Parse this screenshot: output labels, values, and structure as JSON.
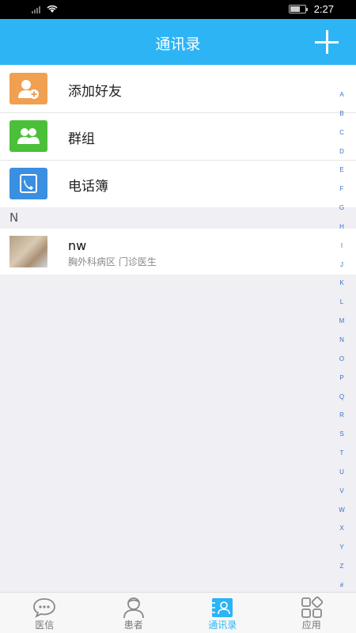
{
  "status_bar": {
    "time": "2:27"
  },
  "header": {
    "title": "通讯录"
  },
  "menu": [
    {
      "label": "添加好友",
      "icon": "add-friend-icon",
      "color": "#f0a050"
    },
    {
      "label": "群组",
      "icon": "group-icon",
      "color": "#4cbf3a"
    },
    {
      "label": "电话簿",
      "icon": "phonebook-icon",
      "color": "#3a8fe0"
    }
  ],
  "section": {
    "letter": "N"
  },
  "contacts": [
    {
      "name": "nw",
      "detail": "胸外科病区 门诊医生"
    }
  ],
  "index_letters": [
    "A",
    "B",
    "C",
    "D",
    "E",
    "F",
    "G",
    "H",
    "I",
    "J",
    "K",
    "L",
    "M",
    "N",
    "O",
    "P",
    "Q",
    "R",
    "S",
    "T",
    "U",
    "V",
    "W",
    "X",
    "Y",
    "Z",
    "#"
  ],
  "bottom_nav": [
    {
      "label": "医信",
      "icon": "chat-bubble-icon",
      "active": false
    },
    {
      "label": "患者",
      "icon": "patient-icon",
      "active": false
    },
    {
      "label": "通讯录",
      "icon": "contacts-icon",
      "active": true
    },
    {
      "label": "应用",
      "icon": "apps-grid-icon",
      "active": false
    }
  ],
  "colors": {
    "accent": "#2db4f5",
    "background": "#efeff4",
    "index_letter": "#3a73c8"
  }
}
